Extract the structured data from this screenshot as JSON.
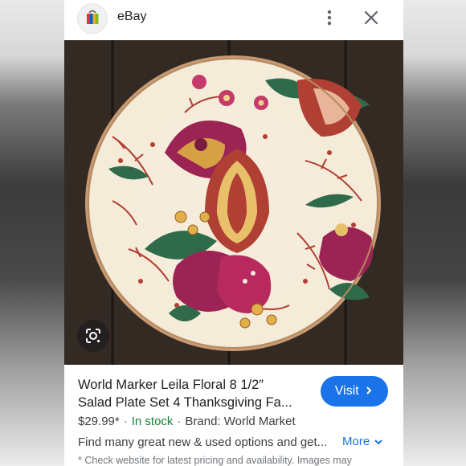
{
  "header": {
    "site_name": "eBay"
  },
  "product": {
    "title_line1": "World Marker Leila Floral 8 1/2″",
    "title_line2": "Salad Plate Set 4 Thanksgiving Fa...",
    "visit_label": "Visit",
    "price": "$29.99*",
    "stock_status": "In stock",
    "brand": "Brand: World Market",
    "description": "Find many great new & used options and get...",
    "more_label": "More",
    "disclaimer": "* Check website for latest pricing and availability. Images may"
  },
  "icons": {
    "site_logo": "ebay-bag-icon",
    "menu": "more-vert-icon",
    "close": "close-icon",
    "lens": "google-lens-icon",
    "visit": "chevron-right-icon",
    "more": "chevron-down-icon"
  },
  "colors": {
    "accent": "#1a73e8",
    "in_stock": "#188038",
    "plate_red": "#a83a32",
    "plate_magenta": "#9c2455",
    "plate_green": "#2f6b4a",
    "plate_cream": "#f4ebd8"
  }
}
